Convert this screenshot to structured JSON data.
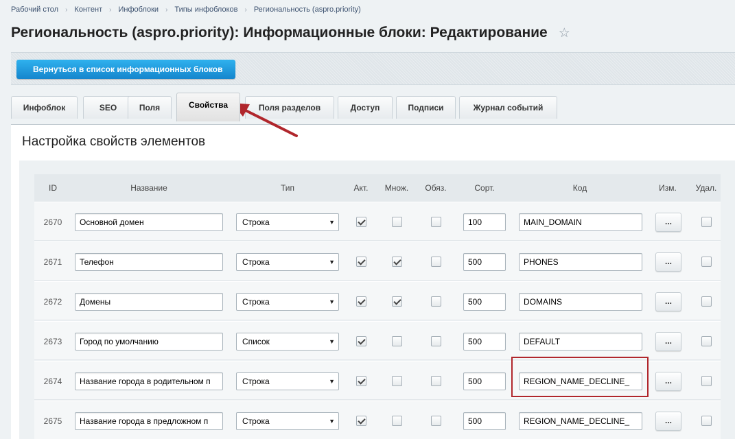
{
  "breadcrumb": [
    "Рабочий стол",
    "Контент",
    "Инфоблоки",
    "Типы инфоблоков",
    "Региональность (aspro.priority)"
  ],
  "breadcrumb_separator": "›",
  "title": "Региональность (aspro.priority): Информационные блоки: Редактирование",
  "toolbar": {
    "back_label": "Вернуться в список информационных блоков"
  },
  "tabs": [
    {
      "label": "Инфоблок",
      "active": false
    },
    {
      "label": "SEO",
      "active": false
    },
    {
      "label": "Поля",
      "active": false
    },
    {
      "label": "Свойства",
      "active": true
    },
    {
      "label": "Поля разделов",
      "active": false
    },
    {
      "label": "Доступ",
      "active": false
    },
    {
      "label": "Подписи",
      "active": false
    },
    {
      "label": "Журнал событий",
      "active": false
    }
  ],
  "section_title": "Настройка свойств элементов",
  "columns": {
    "id": "ID",
    "name": "Название",
    "type": "Тип",
    "active": "Акт.",
    "multiple": "Множ.",
    "required": "Обяз.",
    "sort": "Сорт.",
    "code": "Код",
    "edit": "Изм.",
    "delete": "Удал."
  },
  "edit_button_label": "...",
  "rows": [
    {
      "id": "2670",
      "name": "Основной домен",
      "type": "Строка",
      "active": true,
      "multiple": false,
      "required": false,
      "sort": "100",
      "code": "MAIN_DOMAIN",
      "delete": false
    },
    {
      "id": "2671",
      "name": "Телефон",
      "type": "Строка",
      "active": true,
      "multiple": true,
      "required": false,
      "sort": "500",
      "code": "PHONES",
      "delete": false
    },
    {
      "id": "2672",
      "name": "Домены",
      "type": "Строка",
      "active": true,
      "multiple": true,
      "required": false,
      "sort": "500",
      "code": "DOMAINS",
      "delete": false
    },
    {
      "id": "2673",
      "name": "Город по умолчанию",
      "type": "Список",
      "active": true,
      "multiple": false,
      "required": false,
      "sort": "500",
      "code": "DEFAULT",
      "delete": false
    },
    {
      "id": "2674",
      "name": "Название города в родительном п",
      "type": "Строка",
      "active": true,
      "multiple": false,
      "required": false,
      "sort": "500",
      "code": "REGION_NAME_DECLINE_",
      "delete": false
    },
    {
      "id": "2675",
      "name": "Название города в предложном п",
      "type": "Строка",
      "active": true,
      "multiple": false,
      "required": false,
      "sort": "500",
      "code": "REGION_NAME_DECLINE_",
      "delete": false
    }
  ],
  "colors": {
    "accent": "#1d9be0",
    "highlight": "#b0262c"
  }
}
